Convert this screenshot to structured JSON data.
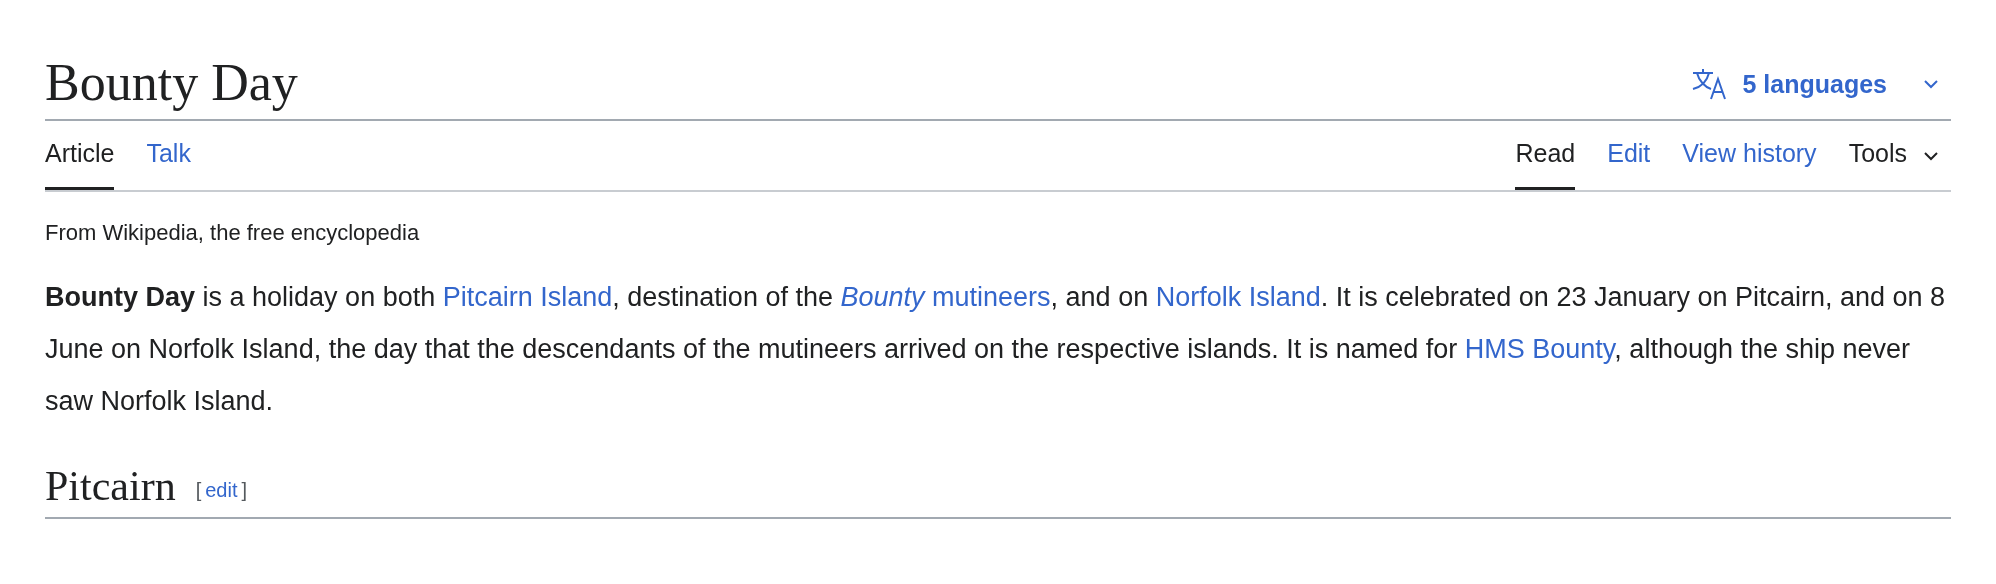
{
  "title": "Bounty Day",
  "languages": {
    "label": "5 languages"
  },
  "left_tabs": [
    {
      "label": "Article",
      "selected": true
    },
    {
      "label": "Talk",
      "selected": false
    }
  ],
  "right_tabs": [
    {
      "label": "Read",
      "kind": "tab",
      "selected": true
    },
    {
      "label": "Edit",
      "kind": "tab",
      "selected": false
    },
    {
      "label": "View history",
      "kind": "tab",
      "selected": false
    },
    {
      "label": "Tools",
      "kind": "menu",
      "selected": false
    }
  ],
  "tagline": "From Wikipedia, the free encyclopedia",
  "paragraph": [
    {
      "kind": "bold",
      "text": "Bounty Day"
    },
    {
      "kind": "text",
      "text": " is a holiday on both "
    },
    {
      "kind": "link",
      "text": "Pitcairn Island"
    },
    {
      "kind": "text",
      "text": ", destination of the "
    },
    {
      "kind": "link",
      "text": "*Bounty* mutineers"
    },
    {
      "kind": "text",
      "text": ", and on "
    },
    {
      "kind": "link",
      "text": "Norfolk Island"
    },
    {
      "kind": "text",
      "text": ". It is celebrated on 23 January on Pitcairn, and on 8 June on Norfolk Island, the day that the descendants of the mutineers arrived on the respective islands. It is named for "
    },
    {
      "kind": "link",
      "text": "HMS Bounty"
    },
    {
      "kind": "text",
      "text": ", although the ship never saw Norfolk Island."
    }
  ],
  "section": {
    "heading": "Pitcairn",
    "edit_open": "[",
    "edit_link": "edit",
    "edit_close": "]"
  }
}
